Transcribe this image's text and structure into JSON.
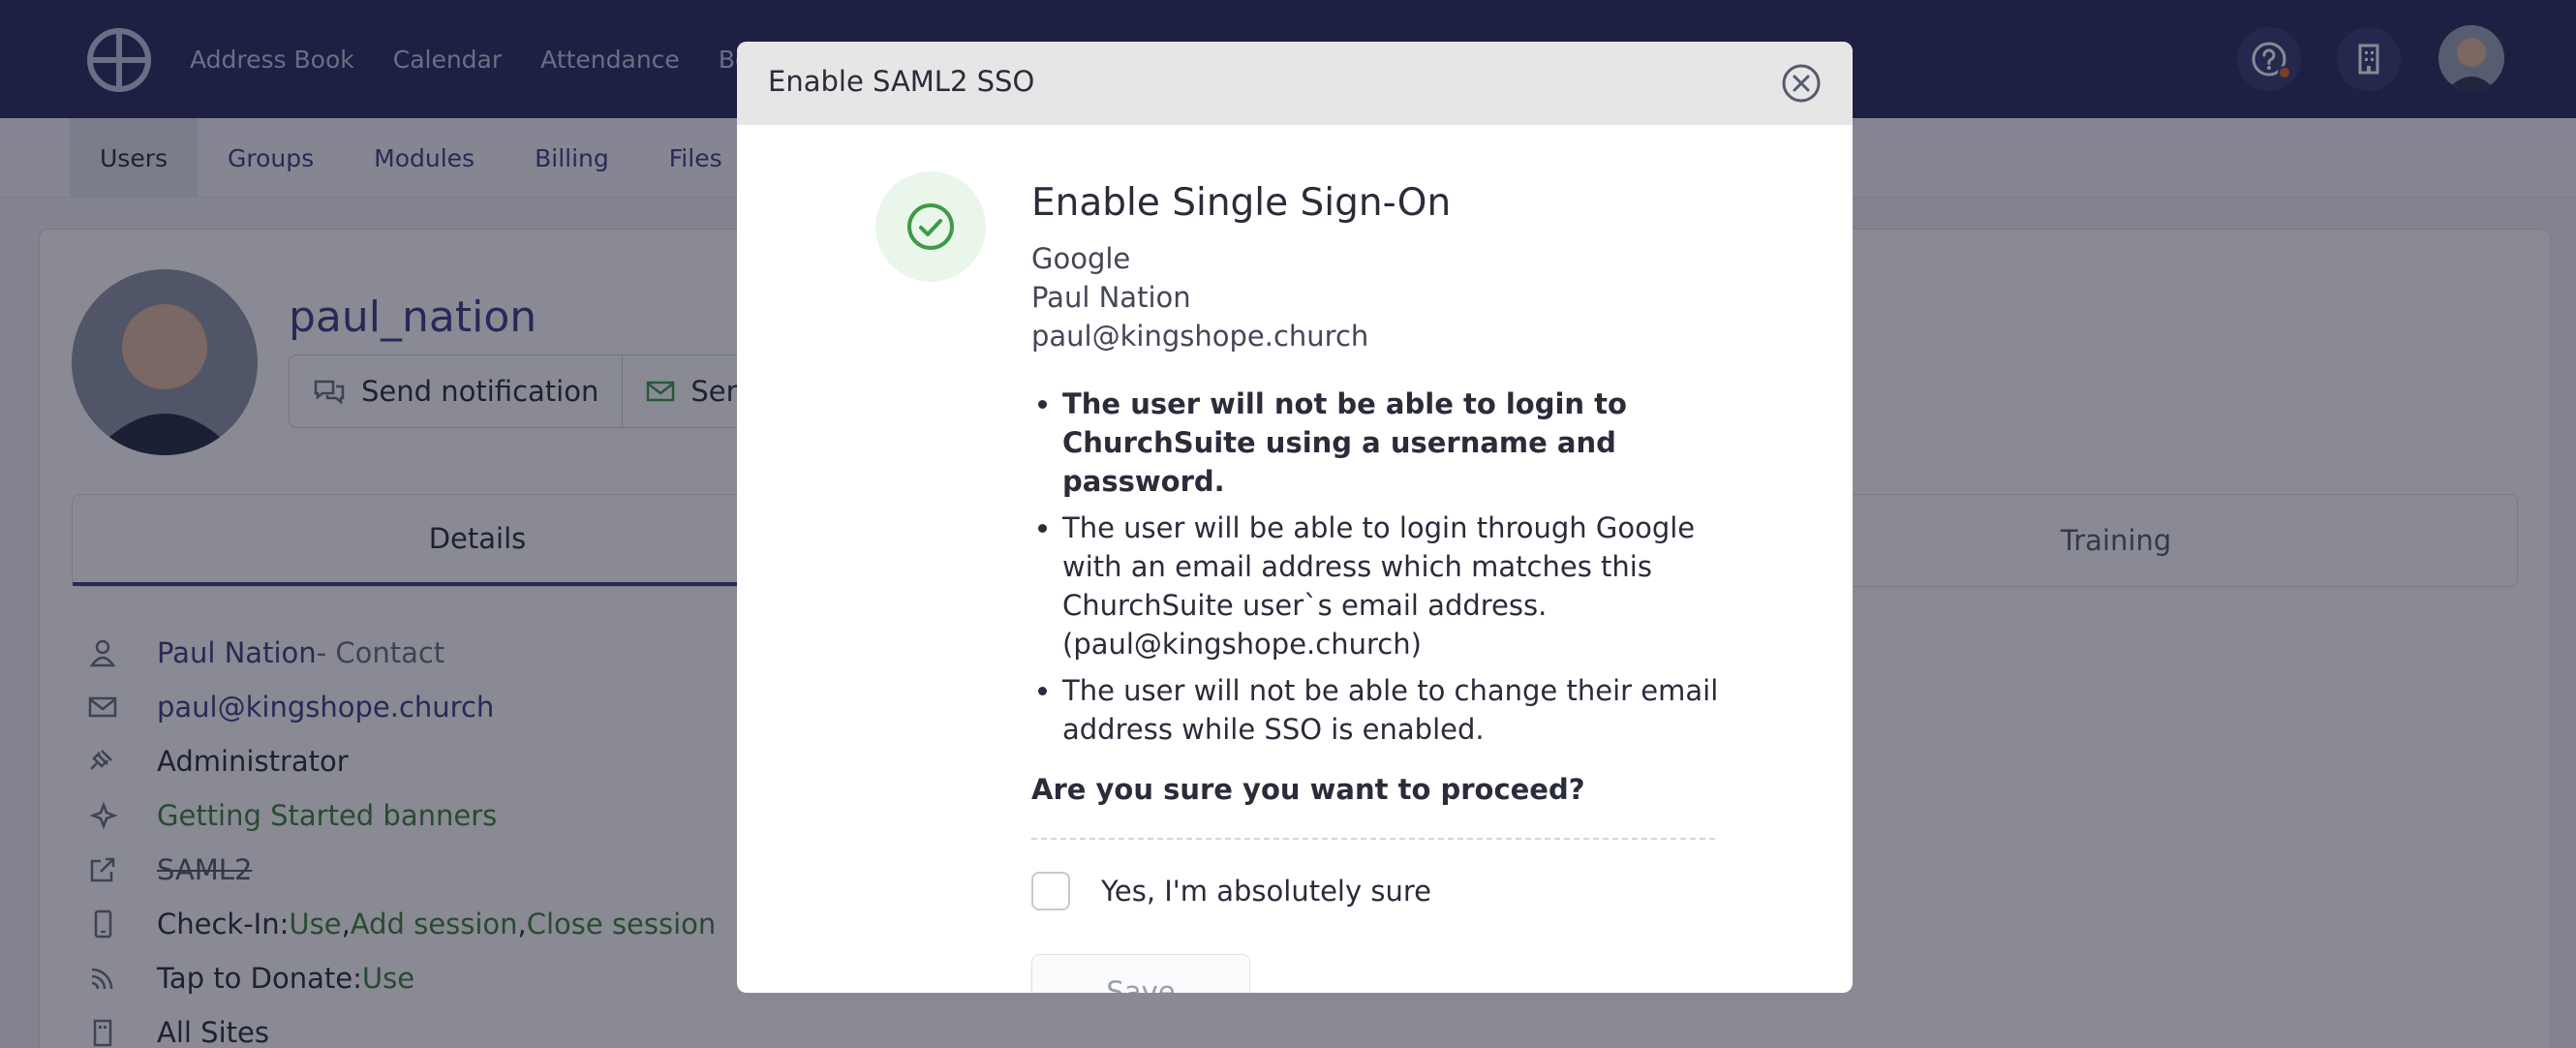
{
  "topnav": {
    "items": [
      "Address Book",
      "Calendar",
      "Attendance",
      "Book"
    ]
  },
  "subnav": {
    "items": [
      "Users",
      "Groups",
      "Modules",
      "Billing",
      "Files"
    ],
    "active": "Users"
  },
  "profile": {
    "username": "paul_nation",
    "buttons": [
      "Send notification",
      "Send p"
    ]
  },
  "tabs": {
    "details": "Details",
    "training": "Training"
  },
  "details": {
    "contact_name": "Paul Nation",
    "contact_suffix": " - Contact",
    "email": "paul@kingshope.church",
    "role": "Administrator",
    "banners": "Getting Started banners",
    "saml": "SAML2",
    "checkin_label": "Check-In: ",
    "checkin_use": "Use",
    "sep": ", ",
    "checkin_add": "Add session",
    "checkin_close": "Close session",
    "tap_label": "Tap to Donate: ",
    "tap_use": "Use",
    "sites": "All Sites"
  },
  "modal": {
    "title": "Enable SAML2 SSO",
    "heading": "Enable Single Sign-On",
    "provider": "Google",
    "user_name": "Paul Nation",
    "user_email": "paul@kingshope.church",
    "bullets": [
      "The user will not be able to login to ChurchSuite using a username and password.",
      "The user will be able to login through Google with an email address which matches this ChurchSuite user`s email address. (paul@kingshope.church)",
      "The user will not be able to change their email address while SSO is enabled."
    ],
    "confirm_question": "Are you sure you want to proceed?",
    "checkbox_label": "Yes, I'm absolutely sure",
    "checkbox_checked": false,
    "save_label": "Save"
  },
  "colors": {
    "navy": "#262a5c",
    "accent": "#3a3f86",
    "success": "#3f9a47",
    "notification": "#e8632d"
  }
}
